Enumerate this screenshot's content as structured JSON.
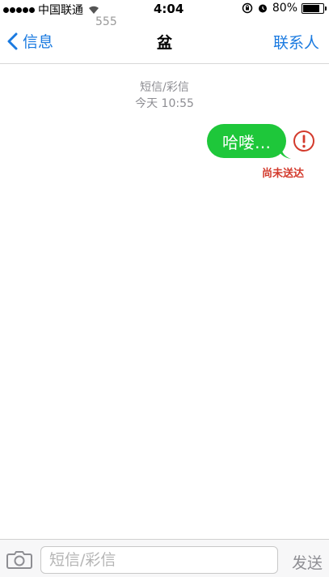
{
  "status_bar": {
    "carrier": "中国联通",
    "time": "4:04",
    "battery": "80%",
    "battery_level_fraction": 0.8
  },
  "ghost_number": "555",
  "nav": {
    "back_label": "信息",
    "title": "盆",
    "contacts_label": "联系人"
  },
  "thread": {
    "type_label": "短信/彩信",
    "timestamp": "今天 10:55"
  },
  "message": {
    "text": "哈喽…",
    "status": "尚未送达",
    "bubble_color": "#1ec73a",
    "error_color": "#d33a2c"
  },
  "input_bar": {
    "placeholder": "短信/彩信",
    "send_label": "发送"
  },
  "colors": {
    "accent": "#1a7ae0"
  }
}
